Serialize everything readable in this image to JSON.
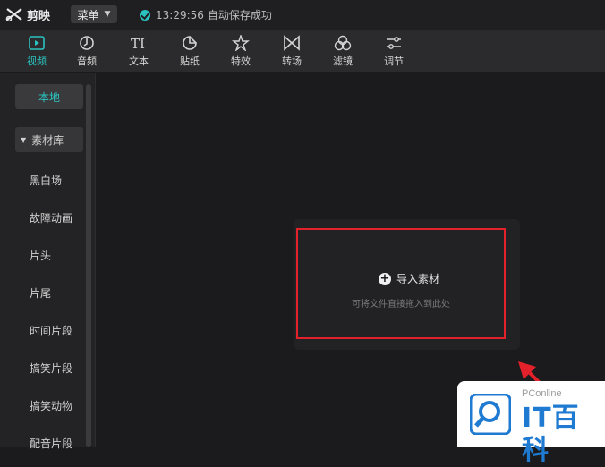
{
  "app": {
    "title": "剪映"
  },
  "topbar": {
    "menu_label": "菜单",
    "status_time": "13:29:56",
    "status_text": "自动保存成功",
    "status_color": "#2bc3c0"
  },
  "toolbar": {
    "items": [
      {
        "label": "视频",
        "icon": "video-icon",
        "active": true
      },
      {
        "label": "音频",
        "icon": "audio-icon"
      },
      {
        "label": "文本",
        "icon": "text-icon"
      },
      {
        "label": "贴纸",
        "icon": "sticker-icon"
      },
      {
        "label": "特效",
        "icon": "effects-icon"
      },
      {
        "label": "转场",
        "icon": "transition-icon"
      },
      {
        "label": "滤镜",
        "icon": "filter-icon"
      },
      {
        "label": "调节",
        "icon": "adjust-icon"
      }
    ]
  },
  "sidebar": {
    "items": [
      {
        "label": "本地",
        "active": true
      },
      {
        "label": "素材库",
        "group": true
      },
      {
        "label": "黑白场"
      },
      {
        "label": "故障动画"
      },
      {
        "label": "片头"
      },
      {
        "label": "片尾"
      },
      {
        "label": "时间片段"
      },
      {
        "label": "搞笑片段"
      },
      {
        "label": "搞笑动物"
      },
      {
        "label": "配音片段"
      }
    ]
  },
  "main": {
    "import_label": "导入素材",
    "import_hint": "可将文件直接拖入到此处",
    "highlight_color": "#e2212b"
  },
  "watermark": {
    "brand": "PConline",
    "name": "IT百科"
  }
}
